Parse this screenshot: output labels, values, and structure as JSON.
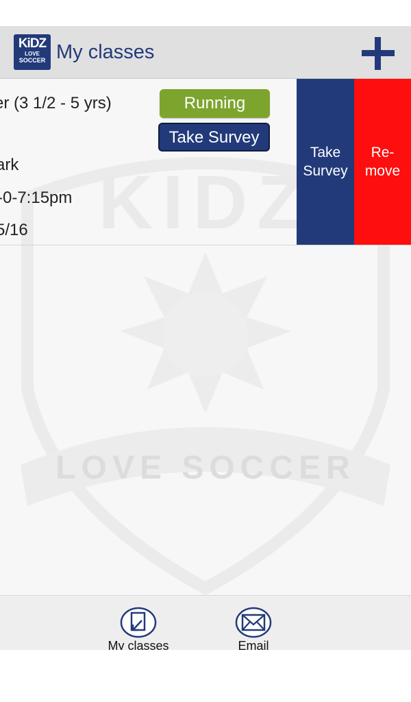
{
  "header": {
    "logo": {
      "line1": "KiDZ",
      "line2": "LOVE",
      "line3": "SOCCER"
    },
    "title": "My classes",
    "add_icon": "plus-icon"
  },
  "watermark": {
    "kidz": "KIDZ",
    "love_soccer": "LOVE SOCCER"
  },
  "class_row": {
    "name": "er (3 1/2 - 5 yrs)",
    "location": "ark",
    "time": "-0-7:15pm",
    "date": "5/16",
    "status": "Running",
    "survey_button": "Take Survey"
  },
  "swipe_actions": {
    "take_survey": "Take\nSurvey",
    "remove": "Re-\nmove"
  },
  "tabbar": {
    "my_classes": {
      "label": "My classes",
      "icon": "document-arrow-icon"
    },
    "email": {
      "label": "Email",
      "icon": "envelope-icon"
    }
  },
  "colors": {
    "brand": "#223a7a",
    "running": "#7da52e",
    "remove": "#fe0e0e"
  }
}
